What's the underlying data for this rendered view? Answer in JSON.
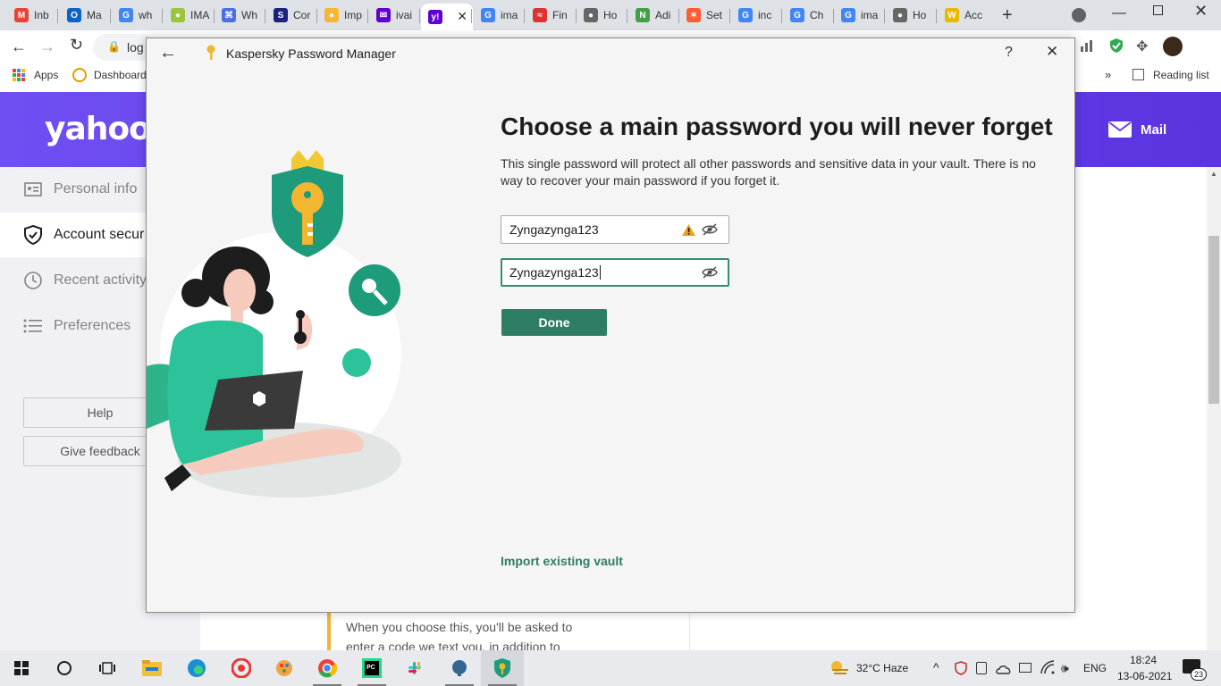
{
  "browser": {
    "tabs": [
      {
        "label": "Inb",
        "icon": "gmail-icon",
        "color": "#ea4335",
        "glyph": "M"
      },
      {
        "label": "Ma",
        "icon": "outlook-icon",
        "color": "#0a64c8",
        "glyph": "O"
      },
      {
        "label": "wh",
        "icon": "google-icon",
        "color": "#4285f4",
        "glyph": "G"
      },
      {
        "label": "IMA",
        "icon": "clock-favicon-icon",
        "color": "#9bc53d",
        "glyph": "●"
      },
      {
        "label": "Wh",
        "icon": "command-icon",
        "color": "#4a6ee0",
        "glyph": "⌘"
      },
      {
        "label": "Cor",
        "icon": "sb-icon",
        "color": "#1a237e",
        "glyph": "S"
      },
      {
        "label": "Imp",
        "icon": "smile-icon",
        "color": "#f7b731",
        "glyph": "●"
      },
      {
        "label": "ivai",
        "icon": "envelope-favicon-icon",
        "color": "#6001d2",
        "glyph": "✉"
      },
      {
        "label": "",
        "icon": "yahoo-favicon-icon",
        "color": "#6001d2",
        "glyph": "y!"
      },
      {
        "label": "ima",
        "icon": "google-icon",
        "color": "#4285f4",
        "glyph": "G"
      },
      {
        "label": "Fin",
        "icon": "wave-icon",
        "color": "#d33",
        "glyph": "≈"
      },
      {
        "label": "Ho",
        "icon": "globe-icon",
        "color": "#666",
        "glyph": "●"
      },
      {
        "label": "Adi",
        "icon": "n-icon",
        "color": "#43a047",
        "glyph": "N"
      },
      {
        "label": "Set",
        "icon": "hubspot-icon",
        "color": "#ff5c35",
        "glyph": "✶"
      },
      {
        "label": "inc",
        "icon": "google-icon",
        "color": "#4285f4",
        "glyph": "G"
      },
      {
        "label": "Ch",
        "icon": "google-icon",
        "color": "#4285f4",
        "glyph": "G"
      },
      {
        "label": "ima",
        "icon": "google-icon",
        "color": "#4285f4",
        "glyph": "G"
      },
      {
        "label": "Ho",
        "icon": "globe-icon",
        "color": "#666",
        "glyph": "●"
      },
      {
        "label": "Acc",
        "icon": "w-icon",
        "color": "#e8b900",
        "glyph": "W"
      }
    ],
    "address_fragment": "log",
    "bookmarks": {
      "apps": "Apps",
      "dashboard": "Dashboard",
      "reading_list": "Reading list"
    }
  },
  "yahoo": {
    "logo": "yahoo!",
    "mail": "Mail",
    "nav": [
      {
        "label": "Personal info",
        "icon": "id-card-icon"
      },
      {
        "label": "Account secur",
        "icon": "shield-icon"
      },
      {
        "label": "Recent activity",
        "icon": "clock-icon"
      },
      {
        "label": "Preferences",
        "icon": "list-icon"
      }
    ],
    "help": "Help",
    "feedback": "Give feedback",
    "card_line1": "When you choose this, you'll be asked to",
    "card_line2": "enter a code we text you, in addition to"
  },
  "kaspersky": {
    "title": "Kaspersky Password Manager",
    "help_glyph": "?",
    "heading": "Choose a main password you will never forget",
    "description": "This single password will protect all other passwords and sensitive data in your vault. There is no way to recover your main password if you forget it.",
    "password": "Zyngazynga123",
    "confirm_password": "Zyngazynga123",
    "done": "Done",
    "import": "Import existing vault",
    "accent": "#2e7d65"
  },
  "taskbar": {
    "weather": "32°C  Haze",
    "language": "ENG",
    "time": "18:24",
    "date": "13-06-2021",
    "notifications": "23"
  }
}
